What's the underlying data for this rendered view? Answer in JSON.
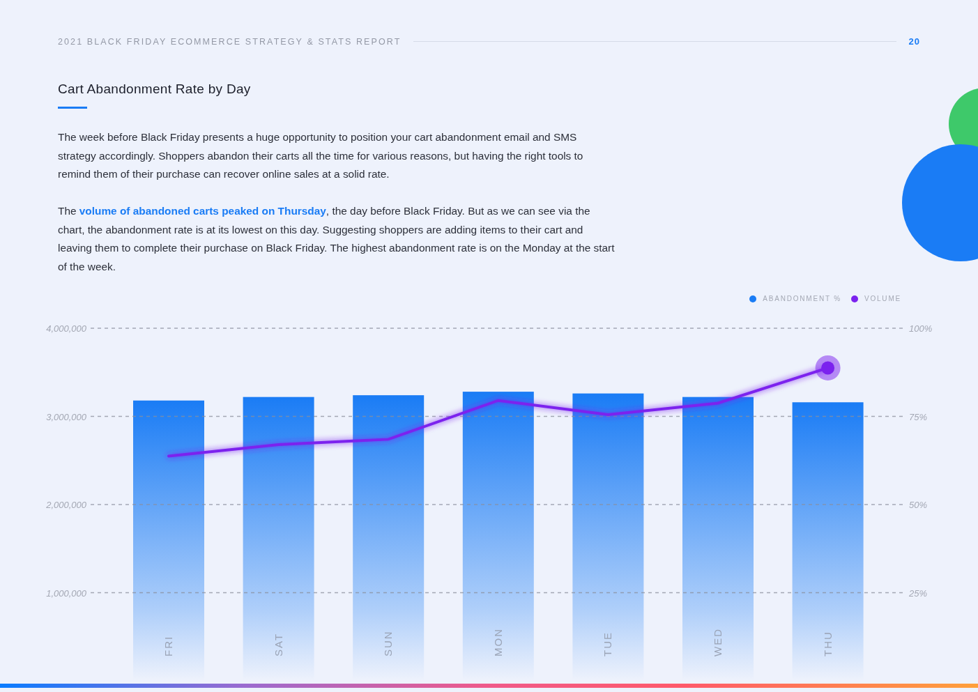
{
  "header": {
    "title": "2021 BLACK FRIDAY ECOMMERCE STRATEGY & STATS REPORT",
    "page_number": "20"
  },
  "section": {
    "heading": "Cart Abandonment Rate by Day",
    "paragraphs": [
      "The week before Black Friday presents a huge opportunity to position your cart abandonment email and SMS strategy accordingly. Shoppers abandon their carts all the time for various reasons, but having the right tools to remind them of their purchase can recover online sales at a solid rate.",
      "The **volume of abandoned carts peaked on Thursday**, the day before Black Friday. But as we can see via the chart, the abandonment rate is at its lowest on this day. Suggesting shoppers are adding items to their cart and leaving them to complete their purchase on Black Friday. The highest abandonment rate is on the Monday at the start of the week."
    ]
  },
  "chart": {
    "chart_data": {
      "type": "bar",
      "categories": [
        "FRI",
        "SAT",
        "SUN",
        "MON",
        "TUE",
        "WED",
        "THU"
      ],
      "series": [
        {
          "name": "ABANDONMENT %",
          "type": "bar",
          "axis": "y2",
          "color": "#1a7cf5",
          "values": [
            79.5,
            80.5,
            81,
            82,
            81.5,
            80.5,
            79
          ]
        },
        {
          "name": "VOLUME",
          "type": "line",
          "axis": "y",
          "color": "#7b22ee",
          "values": [
            2550000,
            2680000,
            2740000,
            3180000,
            3020000,
            3150000,
            3550000
          ]
        }
      ],
      "grid": true,
      "ylim": [
        0,
        4000000
      ],
      "yticks": [
        {
          "value": 1000000,
          "label": "1,000,000"
        },
        {
          "value": 2000000,
          "label": "2,000,000"
        },
        {
          "value": 3000000,
          "label": "3,000,000"
        },
        {
          "value": 4000000,
          "label": "4,000,000"
        }
      ],
      "y2lim": [
        0,
        100
      ],
      "y2ticks": [
        {
          "value": 25,
          "label": "25%"
        },
        {
          "value": 50,
          "label": "50%"
        },
        {
          "value": 75,
          "label": "75%"
        },
        {
          "value": 100,
          "label": "100%"
        }
      ]
    }
  }
}
